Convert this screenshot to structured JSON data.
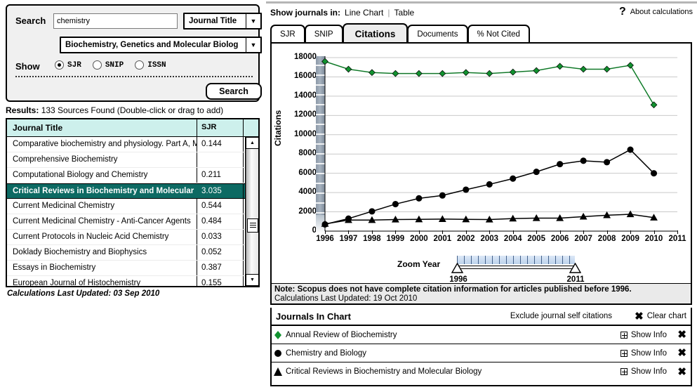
{
  "search_panel": {
    "search_label": "Search",
    "query_value": "chemistry",
    "query_placeholder": "",
    "field_select": "Journal Title",
    "subject_select": "Biochemistry, Genetics and Molecular Biolog",
    "show_label": "Show",
    "radios": [
      {
        "label": "SJR",
        "selected": true
      },
      {
        "label": "SNIP",
        "selected": false
      },
      {
        "label": "ISSN",
        "selected": false
      }
    ],
    "search_button": "Search"
  },
  "results": {
    "header_prefix": "Results:",
    "header_text": "133 Sources Found (Double-click or drag to add)",
    "columns": [
      "Journal Title",
      "SJR"
    ],
    "rows": [
      {
        "title": "Comparative biochemistry and physiology. Part A, Mole",
        "sjr": "0.144",
        "selected": false
      },
      {
        "title": "Comprehensive Biochemistry",
        "sjr": "",
        "selected": false
      },
      {
        "title": "Computational Biology and Chemistry",
        "sjr": "0.211",
        "selected": false
      },
      {
        "title": "Critical Reviews in Biochemistry and Molecular Biology",
        "sjr": "3.035",
        "selected": true
      },
      {
        "title": "Current Medicinal Chemistry",
        "sjr": "0.544",
        "selected": false
      },
      {
        "title": "Current Medicinal Chemistry - Anti-Cancer Agents",
        "sjr": "0.484",
        "selected": false
      },
      {
        "title": "Current Protocols in Nucleic Acid Chemistry",
        "sjr": "0.033",
        "selected": false
      },
      {
        "title": "Doklady Biochemistry and Biophysics",
        "sjr": "0.052",
        "selected": false
      },
      {
        "title": "Essays in Biochemistry",
        "sjr": "0.387",
        "selected": false
      },
      {
        "title": "European Journal of Histochemistry",
        "sjr": "0.155",
        "selected": false
      }
    ],
    "calc_updated": "Calculations Last Updated: 03 Sep 2010"
  },
  "right_header": {
    "show_in_label": "Show journals in:",
    "view_line_chart": "Line Chart",
    "view_table": "Table",
    "divider": "|",
    "about_icon": "question-mark-icon",
    "about_label": "About calculations"
  },
  "tabs": [
    {
      "label": "SJR",
      "active": false
    },
    {
      "label": "SNIP",
      "active": false
    },
    {
      "label": "Citations",
      "active": true
    },
    {
      "label": "Documents",
      "active": false
    },
    {
      "label": "% Not Cited",
      "active": false
    }
  ],
  "zoom_control": {
    "label": "Zoom Year",
    "min_year": "1996",
    "max_year": "2011"
  },
  "note": {
    "line1": "Note: Scopus does not have complete citation information for articles published before 1996.",
    "line2": "Calculations Last Updated: 19 Oct 2010"
  },
  "journals_in_chart": {
    "title": "Journals In Chart",
    "exclude_label": "Exclude journal self citations",
    "clear_label": "Clear chart",
    "show_info_label": "Show Info",
    "rows": [
      {
        "name": "Annual Review of Biochemistry",
        "marker": "diamond",
        "color": "#11922f"
      },
      {
        "name": "Chemistry and Biology",
        "marker": "circle",
        "color": "#000000"
      },
      {
        "name": "Critical Reviews in Biochemistry and Molecular Biology",
        "marker": "triangle",
        "color": "#000000"
      }
    ]
  },
  "chart_data": {
    "type": "line",
    "title": "",
    "xlabel": "",
    "ylabel": "Citations",
    "xlim": [
      1996,
      2011
    ],
    "ylim": [
      0,
      18000
    ],
    "yticks": [
      0,
      2000,
      4000,
      6000,
      8000,
      10000,
      12000,
      14000,
      16000,
      18000
    ],
    "x": [
      1996,
      1997,
      1998,
      1999,
      2000,
      2001,
      2002,
      2003,
      2004,
      2005,
      2006,
      2007,
      2008,
      2009,
      2010
    ],
    "xticklabels": [
      "1996",
      "1997",
      "1998",
      "1999",
      "2000",
      "2001",
      "2002",
      "2003",
      "2004",
      "2005",
      "2006",
      "2007",
      "2008",
      "2009",
      "2010",
      "2011"
    ],
    "grid": true,
    "legend_position": "below-chart",
    "series": [
      {
        "name": "Annual Review of Biochemistry",
        "marker": "diamond",
        "color": "#11922f",
        "values": [
          17600,
          16800,
          16450,
          16350,
          16350,
          16350,
          16450,
          16350,
          16500,
          16650,
          17100,
          16800,
          16800,
          17200,
          13100
        ]
      },
      {
        "name": "Chemistry and Biology",
        "marker": "circle",
        "color": "#000000",
        "values": [
          700,
          1300,
          2050,
          2800,
          3400,
          3700,
          4300,
          4850,
          5450,
          6150,
          6950,
          7300,
          7150,
          8450,
          6000
        ]
      },
      {
        "name": "Critical Reviews in Biochemistry and Molecular Biology",
        "marker": "triangle",
        "color": "#000000",
        "values": [
          750,
          1150,
          1150,
          1200,
          1220,
          1250,
          1220,
          1200,
          1300,
          1350,
          1350,
          1500,
          1650,
          1750,
          1400
        ]
      }
    ]
  }
}
